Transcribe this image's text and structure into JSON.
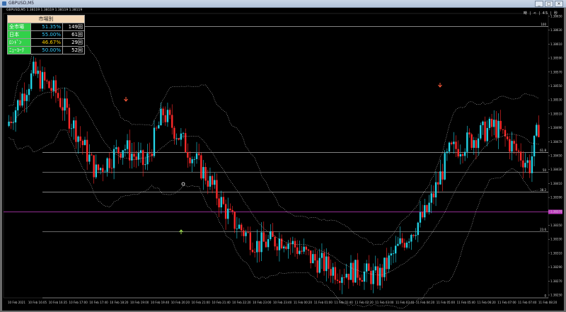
{
  "window": {
    "title": "GBPUSD,M5"
  },
  "chart_header": {
    "info_line": "GBPUSD,M5  1.38119 1.38119 1.38119 1.38119"
  },
  "toolbar": {
    "right_label": "時 | < | 45 | 秒"
  },
  "stats_panel": {
    "header": "市場別",
    "rows": [
      {
        "label": "全市場",
        "percent": "51.35%",
        "count": "149回",
        "color": "#33ccff"
      },
      {
        "label": "日本",
        "percent": "55.00%",
        "count": "61回",
        "color": "#33ccff"
      },
      {
        "label": "ﾛﾝﾄﾞﾝ",
        "percent": "46.67%",
        "count": "29回",
        "color": "#ffd200"
      },
      {
        "label": "ﾆｭｰﾖｰｸ",
        "percent": "50.00%",
        "count": "52回",
        "color": "#33ccff"
      }
    ]
  },
  "levels": [
    {
      "label": "100",
      "price": 1.3864
    },
    {
      "label": "61.8",
      "price": 1.3845
    },
    {
      "label": "50",
      "price": 1.3842
    },
    {
      "label": "38.2",
      "price": 1.3839
    },
    {
      "label": "23.6",
      "price": 1.3833
    },
    {
      "label": "0",
      "price": 1.3823
    }
  ],
  "current_price_line": 1.3836,
  "y_ticks": [
    "1.38650",
    "1.38630",
    "1.38610",
    "1.38590",
    "1.38570",
    "1.38550",
    "1.38530",
    "1.38510",
    "1.38490",
    "1.38470",
    "1.38450",
    "1.38430",
    "1.38410",
    "1.38390",
    "1.38370",
    "1.38350",
    "1.38330",
    "1.38310",
    "1.38290",
    "1.38270",
    "1.38250"
  ],
  "x_ticks": [
    "10 Feb 2021",
    "10 Feb 16:05",
    "10 Feb 16:35",
    "10 Feb 17:00",
    "10 Feb 17:40",
    "10 Feb 18:20",
    "10 Feb 19:00",
    "10 Feb 19:40",
    "10 Feb 20:20",
    "10 Feb 21:00",
    "10 Feb 21:40",
    "10 Feb 22:20",
    "10 Feb 23:00",
    "10 Feb 23:40",
    "11 Feb 00:20",
    "11 Feb 01:00",
    "11 Feb 01:40",
    "11 Feb 02:20",
    "11 Feb 03:00",
    "11 Feb 03:40",
    "11 Feb 04:20",
    "11 Feb 05:00",
    "11 Feb 05:40",
    "11 Feb 06:20",
    "11 Feb 07:00",
    "11 Feb 07:40",
    "11 Feb 08:20"
  ],
  "colors": {
    "up": "#22d3e6",
    "down": "#ff2a2a",
    "level_line": "#cfcfcf",
    "price_line": "#c23cc2",
    "arrow": "#ff5a3a",
    "up_arrow": "#9ee04a"
  }
}
